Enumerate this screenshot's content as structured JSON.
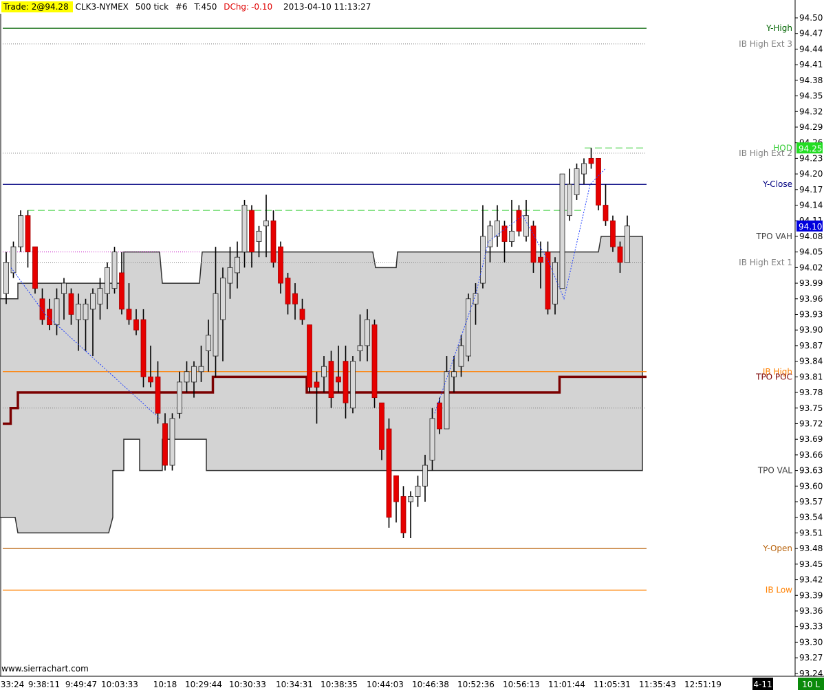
{
  "header": {
    "trade": "Trade: 2@94.28",
    "symbol": "CLK3-NYMEX",
    "period": "500 tick",
    "bar": "#6",
    "ticks": "T:450",
    "dchg_label": "DChg:",
    "dchg_value": "-0.10",
    "datetime": "2013-04-10 11:13:27"
  },
  "watermark": "www.sierrachart.com",
  "colors": {
    "up": "#d8d8d8",
    "down": "#e60000",
    "profile": "#d3d3d3",
    "poc": "#7b0000",
    "ib": "#ff8000",
    "yclose": "#000080",
    "yhigh": "#005000"
  },
  "chart_data": {
    "type": "candlestick",
    "ylim": [
      93.24,
      94.52
    ],
    "y_ticks": [
      "94.50",
      "94.47",
      "94.44",
      "94.41",
      "94.38",
      "94.35",
      "94.32",
      "94.29",
      "94.26",
      "94.23",
      "94.20",
      "94.17",
      "94.14",
      "94.11",
      "94.08",
      "94.05",
      "94.02",
      "93.99",
      "93.96",
      "93.93",
      "93.90",
      "93.87",
      "93.84",
      "93.81",
      "93.78",
      "93.75",
      "93.72",
      "93.69",
      "93.66",
      "93.63",
      "93.60",
      "93.57",
      "93.54",
      "93.51",
      "93.48",
      "93.45",
      "93.42",
      "93.39",
      "93.36",
      "93.33",
      "93.30",
      "93.27",
      "93.24"
    ],
    "x_ticks": [
      "33:24",
      "9:38:11",
      "9:49:47",
      "10:03:33",
      "10:18",
      "10:29:44",
      "10:30:33",
      "10:34:31",
      "10:38:35",
      "10:44:03",
      "10:46:38",
      "10:52:36",
      "10:56:13",
      "11:01:44",
      "11:05:31",
      "11:35:43",
      "12:51:19"
    ],
    "candles": [
      {
        "o": 93.97,
        "h": 94.05,
        "l": 93.95,
        "c": 94.03
      },
      {
        "o": 94.01,
        "h": 94.07,
        "l": 94.0,
        "c": 94.06
      },
      {
        "o": 94.06,
        "h": 94.13,
        "l": 94.05,
        "c": 94.12
      },
      {
        "o": 94.12,
        "h": 94.13,
        "l": 94.02,
        "c": 94.05
      },
      {
        "o": 94.06,
        "h": 94.06,
        "l": 93.97,
        "c": 93.98
      },
      {
        "o": 93.96,
        "h": 93.98,
        "l": 93.91,
        "c": 93.92
      },
      {
        "o": 93.94,
        "h": 93.96,
        "l": 93.9,
        "c": 93.91
      },
      {
        "o": 93.91,
        "h": 93.98,
        "l": 93.89,
        "c": 93.96
      },
      {
        "o": 93.97,
        "h": 94.0,
        "l": 93.92,
        "c": 93.99
      },
      {
        "o": 93.97,
        "h": 93.98,
        "l": 93.91,
        "c": 93.93
      },
      {
        "o": 93.92,
        "h": 93.97,
        "l": 93.86,
        "c": 93.95
      },
      {
        "o": 93.92,
        "h": 93.96,
        "l": 93.86,
        "c": 93.95
      },
      {
        "o": 93.94,
        "h": 93.98,
        "l": 93.85,
        "c": 93.97
      },
      {
        "o": 93.95,
        "h": 94.0,
        "l": 93.92,
        "c": 93.98
      },
      {
        "o": 93.97,
        "h": 94.03,
        "l": 93.94,
        "c": 94.02
      },
      {
        "o": 93.98,
        "h": 94.06,
        "l": 93.97,
        "c": 94.05
      },
      {
        "o": 94.01,
        "h": 94.05,
        "l": 93.93,
        "c": 93.94
      },
      {
        "o": 93.94,
        "h": 93.99,
        "l": 93.91,
        "c": 93.92
      },
      {
        "o": 93.92,
        "h": 93.94,
        "l": 93.89,
        "c": 93.9
      },
      {
        "o": 93.92,
        "h": 93.94,
        "l": 93.79,
        "c": 93.81
      },
      {
        "o": 93.81,
        "h": 93.87,
        "l": 93.79,
        "c": 93.8
      },
      {
        "o": 93.81,
        "h": 93.84,
        "l": 93.72,
        "c": 93.74
      },
      {
        "o": 93.72,
        "h": 93.74,
        "l": 93.63,
        "c": 93.64
      },
      {
        "o": 93.64,
        "h": 93.74,
        "l": 93.63,
        "c": 93.73
      },
      {
        "o": 93.74,
        "h": 93.82,
        "l": 93.73,
        "c": 93.8
      },
      {
        "o": 93.8,
        "h": 93.84,
        "l": 93.78,
        "c": 93.82
      },
      {
        "o": 93.8,
        "h": 93.84,
        "l": 93.77,
        "c": 93.83
      },
      {
        "o": 93.82,
        "h": 93.87,
        "l": 93.8,
        "c": 93.83
      },
      {
        "o": 93.86,
        "h": 93.92,
        "l": 93.82,
        "c": 93.89
      },
      {
        "o": 93.85,
        "h": 94.06,
        "l": 93.81,
        "c": 93.97
      },
      {
        "o": 93.92,
        "h": 94.02,
        "l": 93.84,
        "c": 94.0
      },
      {
        "o": 93.99,
        "h": 94.06,
        "l": 93.96,
        "c": 94.02
      },
      {
        "o": 94.01,
        "h": 94.07,
        "l": 93.98,
        "c": 94.04
      },
      {
        "o": 94.05,
        "h": 94.15,
        "l": 94.02,
        "c": 94.14
      },
      {
        "o": 94.13,
        "h": 94.14,
        "l": 94.02,
        "c": 94.05
      },
      {
        "o": 94.07,
        "h": 94.1,
        "l": 94.04,
        "c": 94.09
      },
      {
        "o": 94.1,
        "h": 94.16,
        "l": 94.04,
        "c": 94.11
      },
      {
        "o": 94.11,
        "h": 94.13,
        "l": 94.02,
        "c": 94.03
      },
      {
        "o": 94.06,
        "h": 94.07,
        "l": 93.97,
        "c": 93.99
      },
      {
        "o": 94.0,
        "h": 94.01,
        "l": 93.93,
        "c": 93.95
      },
      {
        "o": 93.97,
        "h": 93.99,
        "l": 93.92,
        "c": 93.95
      },
      {
        "o": 93.94,
        "h": 93.96,
        "l": 93.91,
        "c": 93.92
      },
      {
        "o": 93.91,
        "h": 93.91,
        "l": 93.78,
        "c": 93.79
      },
      {
        "o": 93.8,
        "h": 93.82,
        "l": 93.72,
        "c": 93.79
      },
      {
        "o": 93.81,
        "h": 93.85,
        "l": 93.78,
        "c": 93.83
      },
      {
        "o": 93.84,
        "h": 93.86,
        "l": 93.75,
        "c": 93.77
      },
      {
        "o": 93.81,
        "h": 93.87,
        "l": 93.78,
        "c": 93.8
      },
      {
        "o": 93.84,
        "h": 93.87,
        "l": 93.73,
        "c": 93.76
      },
      {
        "o": 93.75,
        "h": 93.85,
        "l": 93.74,
        "c": 93.84
      },
      {
        "o": 93.86,
        "h": 93.93,
        "l": 93.84,
        "c": 93.87
      },
      {
        "o": 93.87,
        "h": 93.94,
        "l": 93.84,
        "c": 93.92
      },
      {
        "o": 93.91,
        "h": 93.92,
        "l": 93.75,
        "c": 93.77
      },
      {
        "o": 93.76,
        "h": 93.76,
        "l": 93.65,
        "c": 93.67
      },
      {
        "o": 93.71,
        "h": 93.73,
        "l": 93.52,
        "c": 93.54
      },
      {
        "o": 93.62,
        "h": 93.62,
        "l": 93.53,
        "c": 93.57
      },
      {
        "o": 93.58,
        "h": 93.6,
        "l": 93.5,
        "c": 93.51
      },
      {
        "o": 93.57,
        "h": 93.59,
        "l": 93.5,
        "c": 93.58
      },
      {
        "o": 93.58,
        "h": 93.62,
        "l": 93.56,
        "c": 93.6
      },
      {
        "o": 93.6,
        "h": 93.66,
        "l": 93.57,
        "c": 93.64
      },
      {
        "o": 93.65,
        "h": 93.75,
        "l": 93.63,
        "c": 93.73
      },
      {
        "o": 93.76,
        "h": 93.77,
        "l": 93.7,
        "c": 93.71
      },
      {
        "o": 93.71,
        "h": 93.85,
        "l": 93.71,
        "c": 93.82
      },
      {
        "o": 93.81,
        "h": 93.85,
        "l": 93.78,
        "c": 93.82
      },
      {
        "o": 93.83,
        "h": 93.89,
        "l": 93.81,
        "c": 93.87
      },
      {
        "o": 93.85,
        "h": 93.97,
        "l": 93.84,
        "c": 93.96
      },
      {
        "o": 93.95,
        "h": 93.99,
        "l": 93.91,
        "c": 93.97
      },
      {
        "o": 93.99,
        "h": 94.14,
        "l": 93.98,
        "c": 94.08
      },
      {
        "o": 94.06,
        "h": 94.11,
        "l": 94.03,
        "c": 94.1
      },
      {
        "o": 94.08,
        "h": 94.14,
        "l": 94.06,
        "c": 94.11
      },
      {
        "o": 94.1,
        "h": 94.11,
        "l": 94.03,
        "c": 94.07
      },
      {
        "o": 94.07,
        "h": 94.15,
        "l": 94.06,
        "c": 94.09
      },
      {
        "o": 94.13,
        "h": 94.14,
        "l": 94.08,
        "c": 94.09
      },
      {
        "o": 94.08,
        "h": 94.15,
        "l": 94.07,
        "c": 94.12
      },
      {
        "o": 94.1,
        "h": 94.11,
        "l": 94.01,
        "c": 94.03
      },
      {
        "o": 94.04,
        "h": 94.07,
        "l": 93.98,
        "c": 94.03
      },
      {
        "o": 94.05,
        "h": 94.07,
        "l": 93.93,
        "c": 93.94
      },
      {
        "o": 93.95,
        "h": 94.04,
        "l": 93.93,
        "c": 94.03
      },
      {
        "o": 93.98,
        "h": 94.2,
        "l": 93.98,
        "c": 94.2
      },
      {
        "o": 94.12,
        "h": 94.21,
        "l": 94.11,
        "c": 94.18
      },
      {
        "o": 94.16,
        "h": 94.22,
        "l": 94.15,
        "c": 94.21
      },
      {
        "o": 94.2,
        "h": 94.23,
        "l": 94.18,
        "c": 94.22
      },
      {
        "o": 94.23,
        "h": 94.25,
        "l": 94.21,
        "c": 94.22
      },
      {
        "o": 94.23,
        "h": 94.23,
        "l": 94.13,
        "c": 94.14
      },
      {
        "o": 94.14,
        "h": 94.18,
        "l": 94.1,
        "c": 94.11
      },
      {
        "o": 94.11,
        "h": 94.12,
        "l": 94.05,
        "c": 94.06
      },
      {
        "o": 94.06,
        "h": 94.07,
        "l": 94.01,
        "c": 94.03
      },
      {
        "o": 94.03,
        "h": 94.12,
        "l": 94.03,
        "c": 94.1
      }
    ],
    "profile_value_area": {
      "vah": 94.05,
      "val": 93.63
    },
    "poc_steps": [
      {
        "time_index": 0,
        "value": 93.72
      },
      {
        "time_index": 1,
        "value": 93.75
      },
      {
        "time_index": 2,
        "value": 93.78
      },
      {
        "time_index": 29,
        "value": 93.81
      },
      {
        "time_index": 42,
        "value": 93.78
      },
      {
        "time_index": 77,
        "value": 93.81
      }
    ],
    "levels": [
      {
        "name": "Y-High",
        "value": 94.48,
        "color": "#006400",
        "style": "solid"
      },
      {
        "name": "IB High Ext 3",
        "value": 94.45,
        "color": "#808080",
        "style": "dotted"
      },
      {
        "name": "HOD",
        "value": 94.25,
        "color": "#33cc33",
        "style": "dashed"
      },
      {
        "name": "IB High Ext 2",
        "value": 94.24,
        "color": "#808080",
        "style": "dotted"
      },
      {
        "name": "Y-Close",
        "value": 94.18,
        "color": "#000080",
        "style": "solid"
      },
      {
        "name": "",
        "value": 94.13,
        "color": "#33cc33",
        "style": "dashed"
      },
      {
        "name": "TPO VAH",
        "value": 94.08,
        "color": "#404040",
        "style": "solid"
      },
      {
        "name": "IB High Ext 1",
        "value": 94.03,
        "color": "#808080",
        "style": "dotted"
      },
      {
        "name": "IB High",
        "value": 93.82,
        "color": "#ff8000",
        "style": "solid"
      },
      {
        "name": "TPO POC",
        "value": 93.81,
        "color": "#7b0000",
        "style": "solid"
      },
      {
        "name": "",
        "value": 93.75,
        "color": "#808080",
        "style": "dotted"
      },
      {
        "name": "TPO VAL",
        "value": 93.63,
        "color": "#404040",
        "style": "solid"
      },
      {
        "name": "Y-Open",
        "value": 93.48,
        "color": "#b8620a",
        "style": "solid"
      },
      {
        "name": "IB Low",
        "value": 93.4,
        "color": "#ff8000",
        "style": "solid"
      }
    ],
    "price_markers": [
      {
        "label": "94.25",
        "bg": "#22dd22",
        "fg": "#ffffff"
      },
      {
        "label": "94.10",
        "bg": "#0000dd",
        "fg": "#ffffff"
      }
    ],
    "bottom_labels": [
      "4-11",
      "10 L"
    ]
  }
}
